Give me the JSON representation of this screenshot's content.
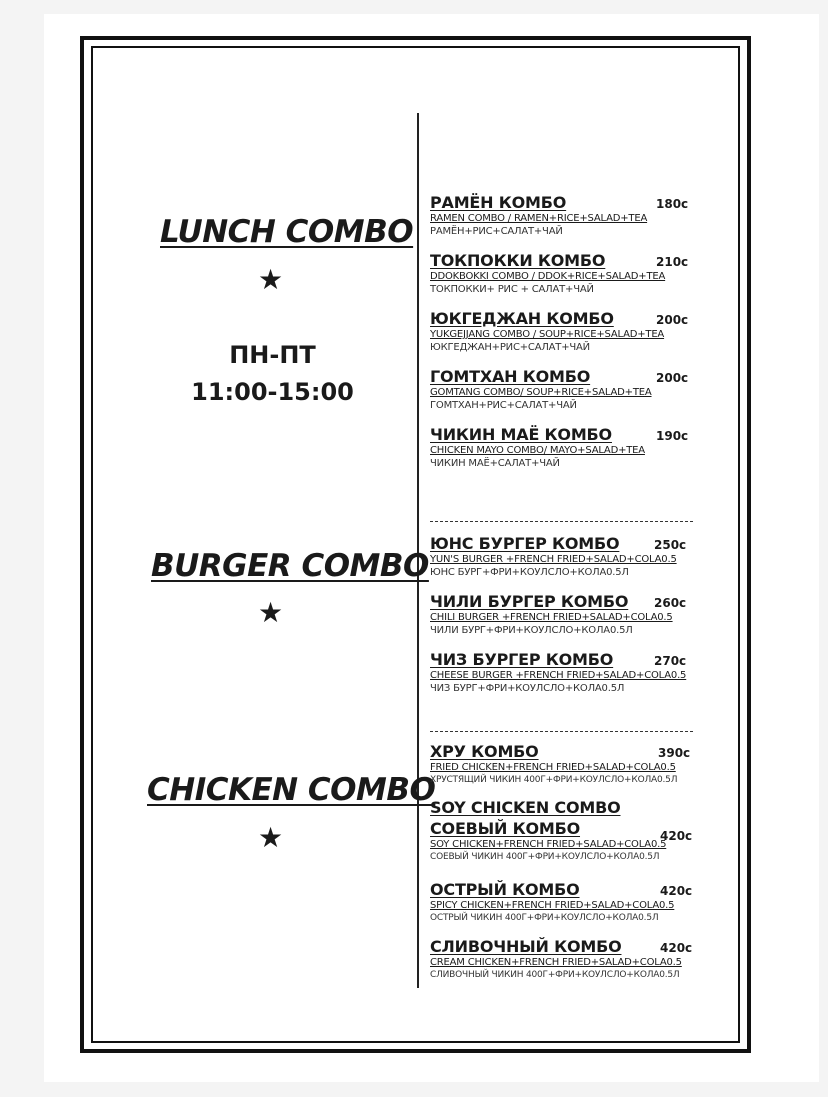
{
  "sections": {
    "lunch": {
      "title": "LUNCH COMBO",
      "star": "★",
      "days": "ПН-ПТ",
      "time": "11:00-15:00"
    },
    "burger": {
      "title": "BURGER COMBO",
      "star": "★"
    },
    "chicken": {
      "title": "CHICKEN COMBO",
      "star": "★"
    }
  },
  "lunch_items": [
    {
      "name": "РАМЁН КОМБО",
      "price": "180с",
      "en": "RAMEN COMBO / RAMEN+RICE+SALAD+TEA",
      "ru": "РАМЁН+РИС+САЛАТ+ЧАЙ"
    },
    {
      "name": "ТОКПОККИ КОМБО",
      "price": "210с",
      "en": "DDOKBOKKI COMBO / DDOK+RICE+SALAD+TEA",
      "ru": "ТОКПОККИ+ РИС + САЛАТ+ЧАЙ"
    },
    {
      "name": "ЮКГЕДЖАН КОМБО",
      "price": "200с",
      "en": "YUKGEJJANG COMBO / SOUP+RICE+SALAD+TEA",
      "ru": "ЮКГЕДЖАН+РИС+САЛАТ+ЧАЙ"
    },
    {
      "name": "ГОМТХАН КОМБО",
      "price": "200с",
      "en": "GOMTANG COMBO/ SOUP+RICE+SALAD+TEA",
      "ru": "ГОМТХАН+РИС+САЛАТ+ЧАЙ"
    },
    {
      "name": "ЧИКИН МАЁ КОМБО",
      "price": "190с",
      "en": "CHICKEN MAYO COMBO/ MAYO+SALAD+TEA",
      "ru": "ЧИКИН МАЁ+САЛАТ+ЧАЙ"
    }
  ],
  "burger_items": [
    {
      "name": "ЮНС БУРГЕР КОМБО",
      "price": "250с",
      "en": "YUN'S BURGER +FRENCH FRIED+SALAD+COLA0.5",
      "ru": "ЮНС БУРГ+ФРИ+КОУЛСЛО+КОЛА0.5Л"
    },
    {
      "name": "ЧИЛИ БУРГЕР КОМБО",
      "price": "260с",
      "en": "CHILI BURGER +FRENCH FRIED+SALAD+COLA0.5",
      "ru": "ЧИЛИ БУРГ+ФРИ+КОУЛСЛО+КОЛА0.5Л"
    },
    {
      "name": "ЧИЗ БУРГЕР КОМБО",
      "price": "270с",
      "en": "CHEESE BURGER +FRENCH FRIED+SALAD+COLA0.5",
      "ru": "ЧИЗ БУРГ+ФРИ+КОУЛСЛО+КОЛА0.5Л"
    }
  ],
  "chicken_items": [
    {
      "name": "ХРУ КОМБО",
      "price": "390с",
      "en": "FRIED CHICKEN+FRENCH FRIED+SALAD+COLA0.5",
      "ru": "ХРУСТЯЩИЙ ЧИКИН 400Г+ФРИ+КОУЛСЛО+КОЛА0.5Л"
    },
    {
      "name": "SOY CHICKEN COMBO",
      "name2": "СОЕВЫЙ КОМБО",
      "price": "420с",
      "en": "SOY CHICKEN+FRENCH FRIED+SALAD+COLA0.5",
      "ru": "СОЕВЫЙ ЧИКИН 400Г+ФРИ+КОУЛСЛО+КОЛА0.5Л"
    },
    {
      "name": "ОСТРЫЙ КОМБО",
      "price": "420с",
      "en": "SPICY CHICKEN+FRENCH FRIED+SALAD+COLA0.5",
      "ru": "ОСТРЫЙ ЧИКИН 400Г+ФРИ+КОУЛСЛО+КОЛА0.5Л"
    },
    {
      "name": "СЛИВОЧНЫЙ КОМБО",
      "price": "420с",
      "en": "CREAM CHICKEN+FRENCH FRIED+SALAD+COLA0.5",
      "ru": "СЛИВОЧНЫЙ ЧИКИН 400Г+ФРИ+КОУЛСЛО+КОЛА0.5Л"
    }
  ]
}
